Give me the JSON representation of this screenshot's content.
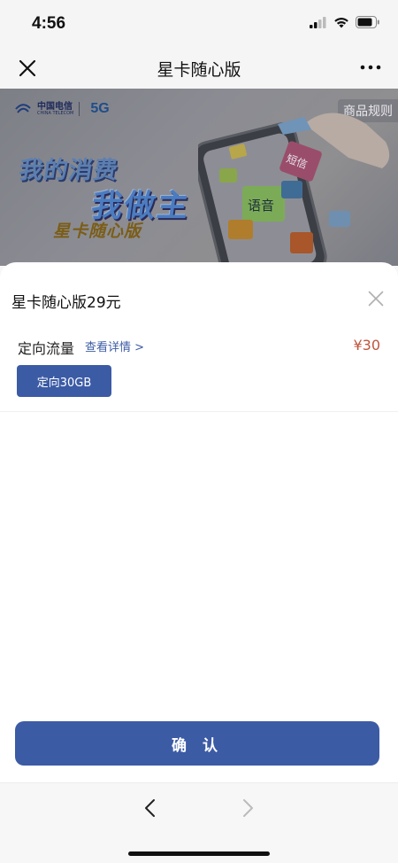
{
  "status": {
    "time": "4:56"
  },
  "nav": {
    "title": "星卡随心版"
  },
  "banner": {
    "rules_label": "商品规则",
    "slogan_line1": "我的消费",
    "slogan_line2": "我做主",
    "product_mark": "星卡随心版",
    "brand_name": "中国电信",
    "brand_en": "CHINA TELECOM",
    "brand_5g": "5G",
    "puzzle_labels": [
      "短信",
      "语音"
    ]
  },
  "sheet": {
    "title": "星卡随心版29元",
    "option_label": "定向流量",
    "option_link": "查看详情 >",
    "option_price": "¥30",
    "chip_label": "定向30GB",
    "confirm_label": "确 认"
  },
  "colors": {
    "accent": "#3c5ba5",
    "price": "#c0543c"
  }
}
